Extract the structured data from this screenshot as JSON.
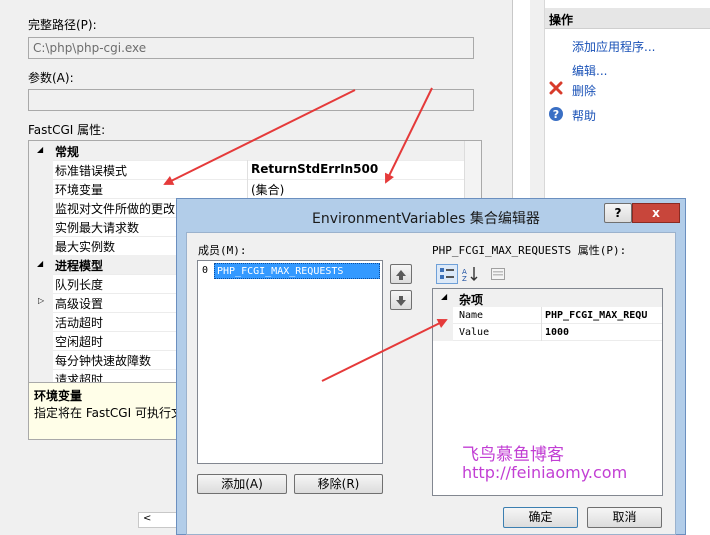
{
  "bg_dialog": {
    "full_path_label": "完整路径(P):",
    "full_path_value": "C:\\php\\php-cgi.exe",
    "args_label": "参数(A):",
    "args_value": "",
    "fastcgi_label": "FastCGI 属性:",
    "property_rows": [
      {
        "kind": "category",
        "name": "常规",
        "value": ""
      },
      {
        "kind": "prop",
        "name": "标准错误模式",
        "value": "ReturnStdErrIn500"
      },
      {
        "kind": "prop",
        "name": "环境变量",
        "value": "(集合)"
      },
      {
        "kind": "prop",
        "name": "监视对文件所做的更改",
        "value": ""
      },
      {
        "kind": "prop",
        "name": "实例最大请求数",
        "value": ""
      },
      {
        "kind": "prop",
        "name": "最大实例数",
        "value": ""
      },
      {
        "kind": "category",
        "name": "进程模型",
        "value": ""
      },
      {
        "kind": "prop",
        "name": "队列长度",
        "value": ""
      },
      {
        "kind": "prop",
        "name": "高级设置",
        "value": ""
      },
      {
        "kind": "prop",
        "name": "活动超时",
        "value": ""
      },
      {
        "kind": "prop",
        "name": "空闲超时",
        "value": ""
      },
      {
        "kind": "prop",
        "name": "每分钟快速故障数",
        "value": ""
      },
      {
        "kind": "prop",
        "name": "请求超时",
        "value": ""
      }
    ],
    "description_title": "环境变量",
    "description_text": "指定将在 FastCGI 可执行文"
  },
  "actions": {
    "header": "操作",
    "items": [
      {
        "label": "添加应用程序...",
        "icon": "none"
      },
      {
        "label": "编辑...",
        "icon": "none"
      },
      {
        "label": "删除",
        "icon": "red-x-icon"
      },
      {
        "label": "帮助",
        "icon": "help-icon"
      }
    ]
  },
  "dialog": {
    "title": "EnvironmentVariables 集合编辑器",
    "help_btn": "?",
    "close_btn": "x",
    "members_label": "成员(M):",
    "members": [
      {
        "index": "0",
        "name": "PHP_FCGI_MAX_REQUESTS"
      }
    ],
    "props_label": "PHP_FCGI_MAX_REQUESTS 属性(P):",
    "category": "杂项",
    "props": [
      {
        "name": "Name",
        "value": "PHP_FCGI_MAX_REQU"
      },
      {
        "name": "Value",
        "value": "1000"
      }
    ],
    "add_btn": "添加(A)",
    "remove_btn": "移除(R)",
    "ok_btn": "确定",
    "cancel_btn": "取消"
  },
  "watermark": {
    "line1": "飞鸟慕鱼博客",
    "line2": "http://feiniaomy.com"
  },
  "colors": {
    "watermark": "#c23fd4",
    "arrow": "#e53a3a",
    "selection": "#3399ff"
  }
}
